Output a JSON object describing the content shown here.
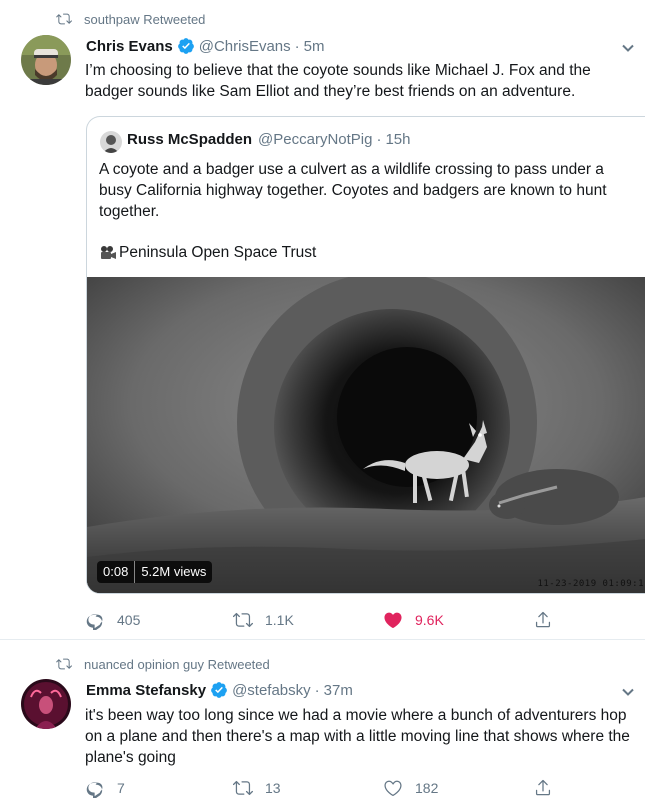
{
  "tweets": [
    {
      "retweeted_by": "southpaw Retweeted",
      "author_name": "Chris Evans",
      "author_handle": "@ChrisEvans",
      "time": "5m",
      "text": "I’m choosing to believe that the coyote sounds like Michael J. Fox and the badger sounds like Sam Elliot and they’re best friends on an adventure.",
      "quote": {
        "author_name": "Russ McSpadden",
        "author_handle": "@PeccaryNotPig",
        "time": "15h",
        "text": "A coyote and a badger use a culvert as a wildlife crossing to pass under a busy California highway together. Coyotes and badgers are known to hunt together.",
        "source": "Peninsula Open Space Trust",
        "video": {
          "duration": "0:08",
          "views": "5.2M views",
          "camera_timestamp": "11-23-2019  01:09:1"
        }
      },
      "actions": {
        "replies": "405",
        "retweets": "1.1K",
        "likes": "9.6K",
        "liked": true
      }
    },
    {
      "retweeted_by": "nuanced opinion guy Retweeted",
      "author_name": "Emma Stefansky",
      "author_handle": "@stefabsky",
      "time": "37m",
      "text": "it's been way too long since we had a movie where a bunch of adventurers hop on a plane and then there's a map with a little moving line that shows where the plane's going",
      "actions": {
        "replies": "7",
        "retweets": "13",
        "likes": "182",
        "liked": false
      }
    }
  ],
  "icons": {
    "retweet": "retweet-icon",
    "reply": "reply-icon",
    "like": "heart-icon",
    "share": "share-icon",
    "verified": "verified-badge-icon",
    "caret": "chevron-down-icon",
    "camera": "movie-camera-icon"
  },
  "colors": {
    "text_primary": "#14171a",
    "text_secondary": "#657786",
    "verified_blue": "#1da1f2",
    "like_red": "#e0245e",
    "border": "#e6ecf0"
  }
}
